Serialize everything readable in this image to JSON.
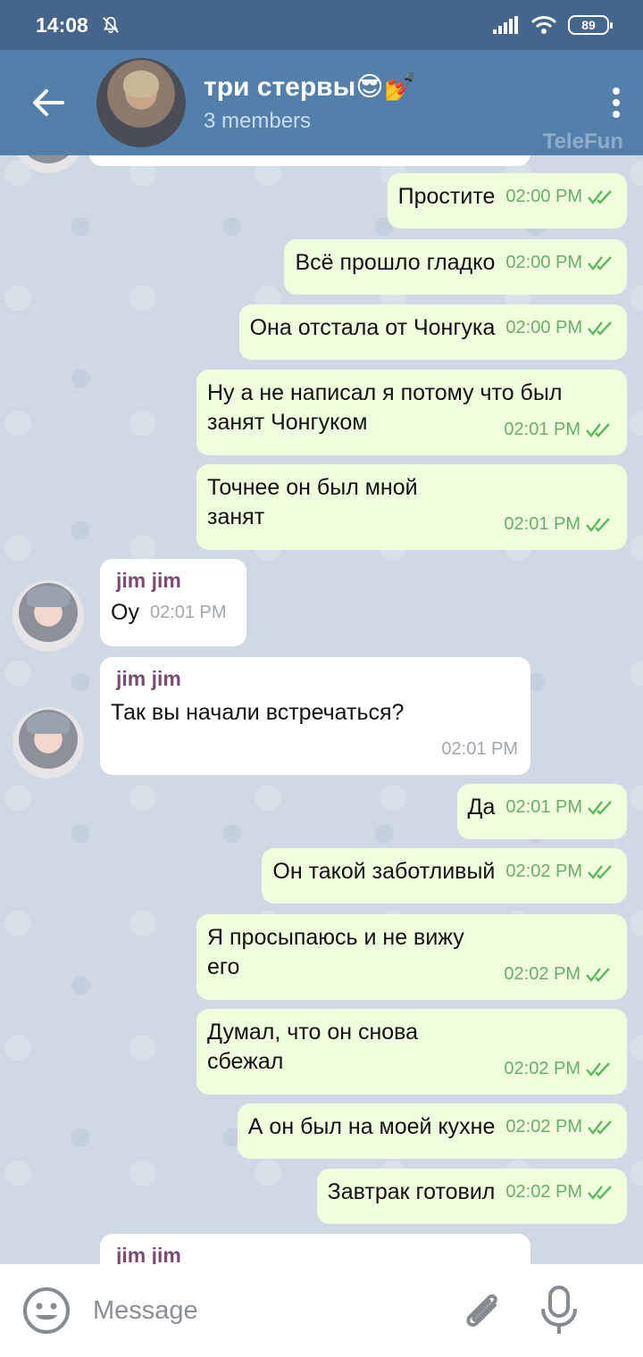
{
  "status_bar": {
    "time": "14:08",
    "battery": "89"
  },
  "header": {
    "title": "три стервы😎💅",
    "subtitle": "3 members",
    "watermark": "TeleFun"
  },
  "messages": [
    {
      "dir": "out",
      "text": "Простите",
      "time": "02:00 PM"
    },
    {
      "dir": "out",
      "text": "Всё прошло гладко",
      "time": "02:00 PM"
    },
    {
      "dir": "out",
      "text": "Она отстала от Чонгука",
      "time": "02:00 PM"
    },
    {
      "dir": "out",
      "text": "Ну а не написал я потому что был занят Чонгуком",
      "time": "02:01 PM"
    },
    {
      "dir": "out",
      "text": "Точнее он был мной занят",
      "time": "02:01 PM"
    },
    {
      "dir": "in",
      "sender": "jim jim",
      "text": "Оу",
      "time": "02:01 PM"
    },
    {
      "dir": "in",
      "sender": "jim jim",
      "text": "Так вы начали встречаться?",
      "time": "02:01 PM"
    },
    {
      "dir": "out",
      "text": "Да",
      "time": "02:01 PM"
    },
    {
      "dir": "out",
      "text": "Он такой заботливый",
      "time": "02:02 PM"
    },
    {
      "dir": "out",
      "text": "Я просыпаюсь и не вижу его",
      "time": "02:02 PM"
    },
    {
      "dir": "out",
      "text": "Думал, что он снова сбежал",
      "time": "02:02 PM"
    },
    {
      "dir": "out",
      "text": "А он был на моей кухне",
      "time": "02:02 PM"
    },
    {
      "dir": "out",
      "text": "Завтрак готовил",
      "time": "02:02 PM"
    },
    {
      "dir": "in",
      "sender": "jim jim"
    }
  ],
  "input": {
    "placeholder": "Message"
  },
  "colors": {
    "status_bar": "#45658d",
    "header": "#5380ab",
    "outgoing_bubble": "#effedd",
    "incoming_bubble": "#ffffff",
    "check_color": "#5cb85c",
    "sender_color": "#7b4a74"
  }
}
